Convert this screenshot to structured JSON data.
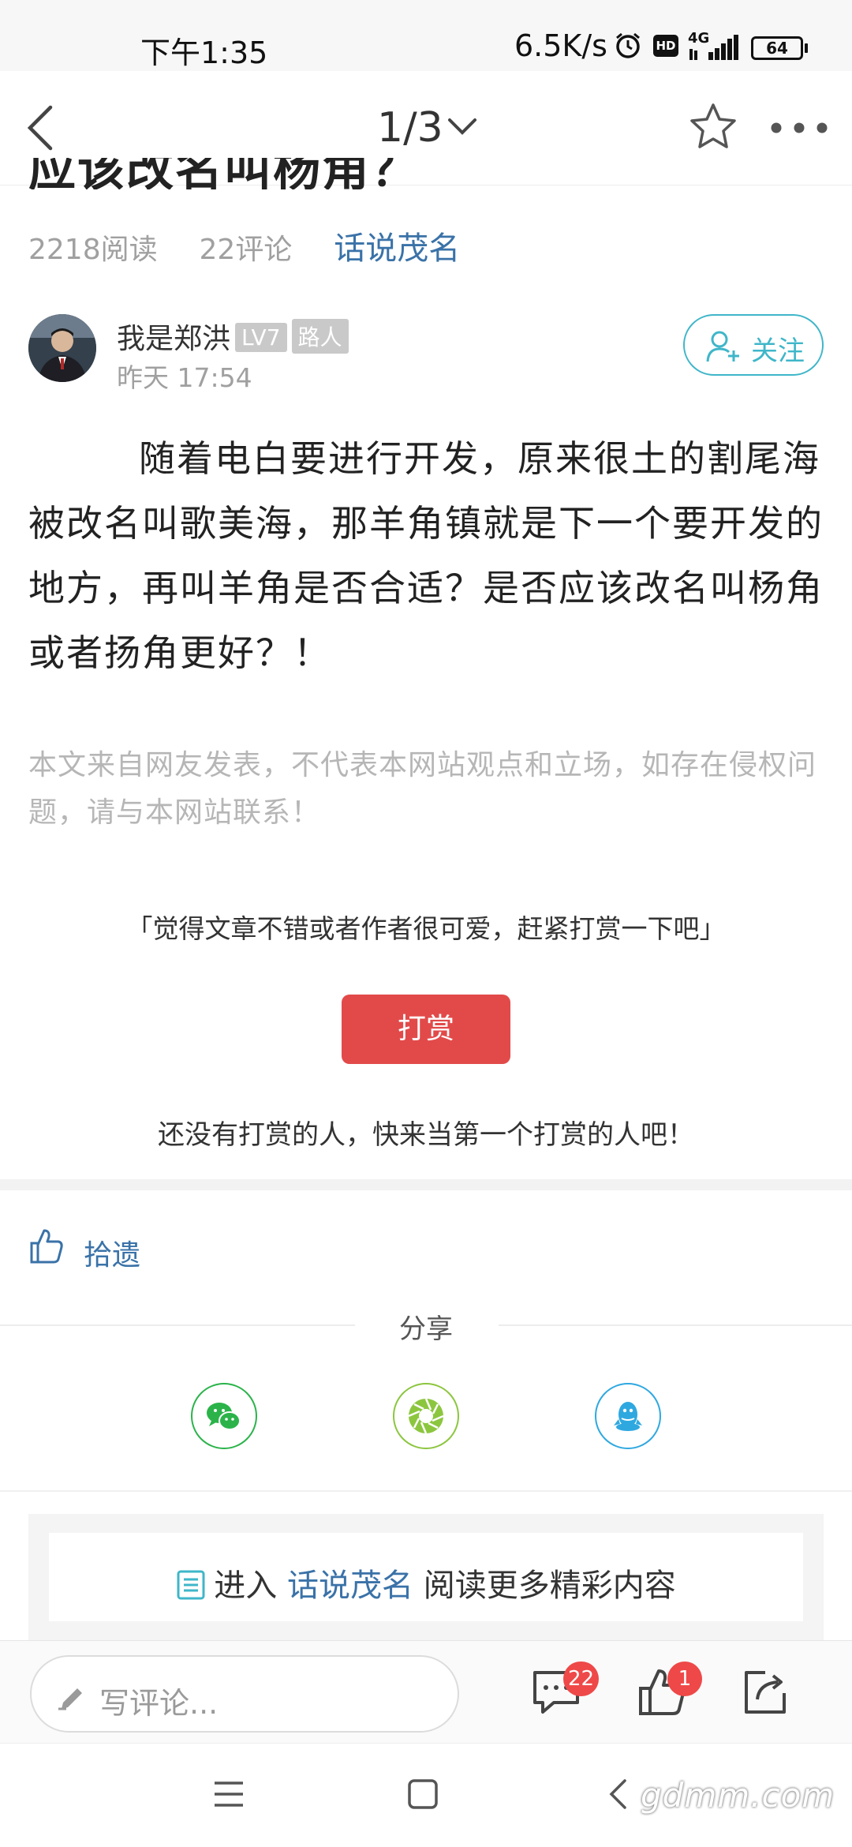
{
  "status_bar": {
    "time": "下午1:35",
    "network_speed": "6.5K/s",
    "network_type": "4G",
    "battery": "64",
    "icons": [
      "alarm-icon",
      "hd-icon",
      "signal-icon",
      "battery-icon"
    ]
  },
  "nav": {
    "page_indicator": "1/3",
    "icons": [
      "back-arrow-icon",
      "chevron-down-icon",
      "star-icon",
      "more-icon"
    ]
  },
  "article": {
    "title_fragment": "应该改名叫杨角？",
    "reads": "2218阅读",
    "comments": "22评论",
    "forum": "话说茂名",
    "author": {
      "name": "我是郑洪",
      "level": "LV7",
      "rank": "路人",
      "time": "昨天 17:54"
    },
    "follow_label": "关注",
    "body": "随着电白要进行开发，原来很土的割尾海被改名叫歌美海，那羊角镇就是下一个要开发的地方，再叫羊角是否合适？是否应该改名叫杨角或者扬角更好？！",
    "disclaimer": "本文来自网友发表，不代表本网站观点和立场，如存在侵权问题，请与本网站联系！"
  },
  "reward": {
    "prompt": "「觉得文章不错或者作者很可爱，赶紧打赏一下吧」",
    "button": "打赏",
    "empty": "还没有打赏的人，快来当第一个打赏的人吧！"
  },
  "actions": {
    "like_label": "拾遗",
    "share_label": "分享",
    "share_targets": [
      "wechat-icon",
      "moments-icon",
      "qq-icon"
    ]
  },
  "enter_forum": {
    "prefix": "进入",
    "forum": "话说茂名",
    "suffix": "阅读更多精彩内容"
  },
  "comment_bar": {
    "placeholder": "写评论...",
    "comment_count": "22",
    "like_count": "1"
  },
  "watermark": "gdmm.com",
  "colors": {
    "accent_blue": "#3a72a8",
    "follow_teal": "#3fb6c9",
    "reward_red": "#e24a4a",
    "badge_red": "#ef4848",
    "wechat_green": "#2bb34a",
    "moments_green": "#8cc63f",
    "qq_blue": "#2fa8e0"
  }
}
